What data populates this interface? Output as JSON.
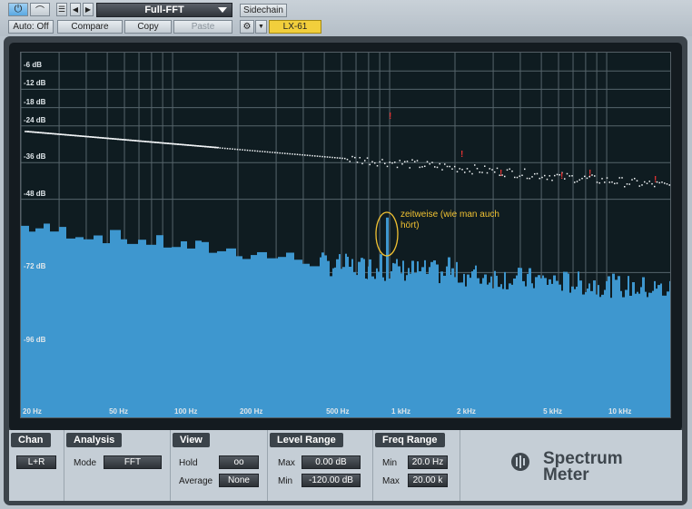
{
  "toolbar": {
    "power_icon": "power-icon",
    "bypass_icon": "bypass-icon",
    "auto_label": "Auto: Off",
    "compare_label": "Compare",
    "copy_label": "Copy",
    "paste_label": "Paste",
    "preset_name": "Full-FFT",
    "sidechain_label": "Sidechain",
    "device_name": "LX-61"
  },
  "analyzer": {
    "db_labels": [
      "-6 dB",
      "-12 dB",
      "-18 dB",
      "-24 dB",
      "-36 dB",
      "-48 dB",
      "-72 dB",
      "-96 dB"
    ],
    "hz_labels": [
      "20 Hz",
      "50 Hz",
      "100 Hz",
      "200 Hz",
      "500 Hz",
      "1 kHz",
      "2 kHz",
      "5 kHz",
      "10 kHz"
    ],
    "annotation": "zeitweise (wie man auch hört)",
    "peak_marker": "!",
    "spectrum_color": "#3e97cf",
    "annotation_color": "#f1c232",
    "marker_color": "#e03232"
  },
  "controls": {
    "chan": {
      "title": "Chan",
      "value": "L+R"
    },
    "analysis": {
      "title": "Analysis",
      "mode_label": "Mode",
      "mode_value": "FFT"
    },
    "view": {
      "title": "View",
      "hold_label": "Hold",
      "hold_value": "oo",
      "average_label": "Average",
      "average_value": "None"
    },
    "level_range": {
      "title": "Level Range",
      "max_label": "Max",
      "max_value": "0.00 dB",
      "min_label": "Min",
      "min_value": "-120.00 dB"
    },
    "freq_range": {
      "title": "Freq Range",
      "min_label": "Min",
      "min_value": "20.0 Hz",
      "max_label": "Max",
      "max_value": "20.00 k"
    }
  },
  "logo": {
    "line1": "Spectrum",
    "line2": "Meter",
    "icon": "presonus-logo-icon"
  }
}
